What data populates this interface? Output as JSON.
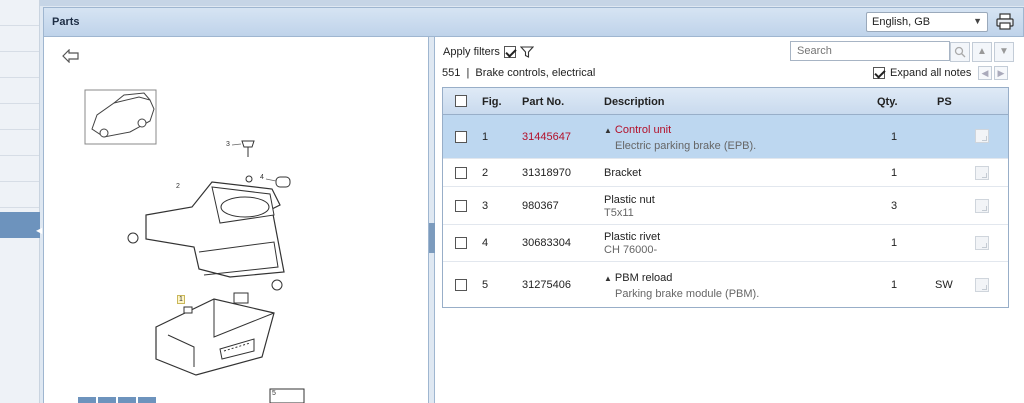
{
  "header": {
    "title": "Parts",
    "language": "English, GB"
  },
  "filters": {
    "apply_label": "Apply filters",
    "apply_checked": true
  },
  "search": {
    "placeholder": "Search"
  },
  "breadcrumb": "551  |  Brake controls, electrical",
  "expand": {
    "label": "Expand all notes",
    "checked": true
  },
  "table": {
    "headers": {
      "fig": "Fig.",
      "part_no": "Part No.",
      "description": "Description",
      "qty": "Qty.",
      "ps": "PS"
    },
    "rows": [
      {
        "fig": "1",
        "part_no": "31445647",
        "description": "Control unit",
        "note": "Electric parking brake (EPB).",
        "qty": "1",
        "ps": "",
        "selected": true,
        "expandable": true
      },
      {
        "fig": "2",
        "part_no": "31318970",
        "description": "Bracket",
        "note": "",
        "qty": "1",
        "ps": "",
        "selected": false,
        "expandable": false
      },
      {
        "fig": "3",
        "part_no": "980367",
        "description": "Plastic nut",
        "note": "T5x11",
        "qty": "3",
        "ps": "",
        "selected": false,
        "expandable": false
      },
      {
        "fig": "4",
        "part_no": "30683304",
        "description": "Plastic rivet",
        "note": "CH 76000-",
        "qty": "1",
        "ps": "",
        "selected": false,
        "expandable": false
      },
      {
        "fig": "5",
        "part_no": "31275406",
        "description": "PBM reload",
        "note": "Parking brake module (PBM).",
        "qty": "1",
        "ps": "SW",
        "selected": false,
        "expandable": true
      }
    ]
  },
  "diagram": {
    "callouts": [
      "1",
      "2",
      "3",
      "4",
      "5"
    ]
  },
  "colors": {
    "accent": "#6d93bd",
    "selected_row": "#bdd7f0",
    "part_red": "#b3102a"
  }
}
